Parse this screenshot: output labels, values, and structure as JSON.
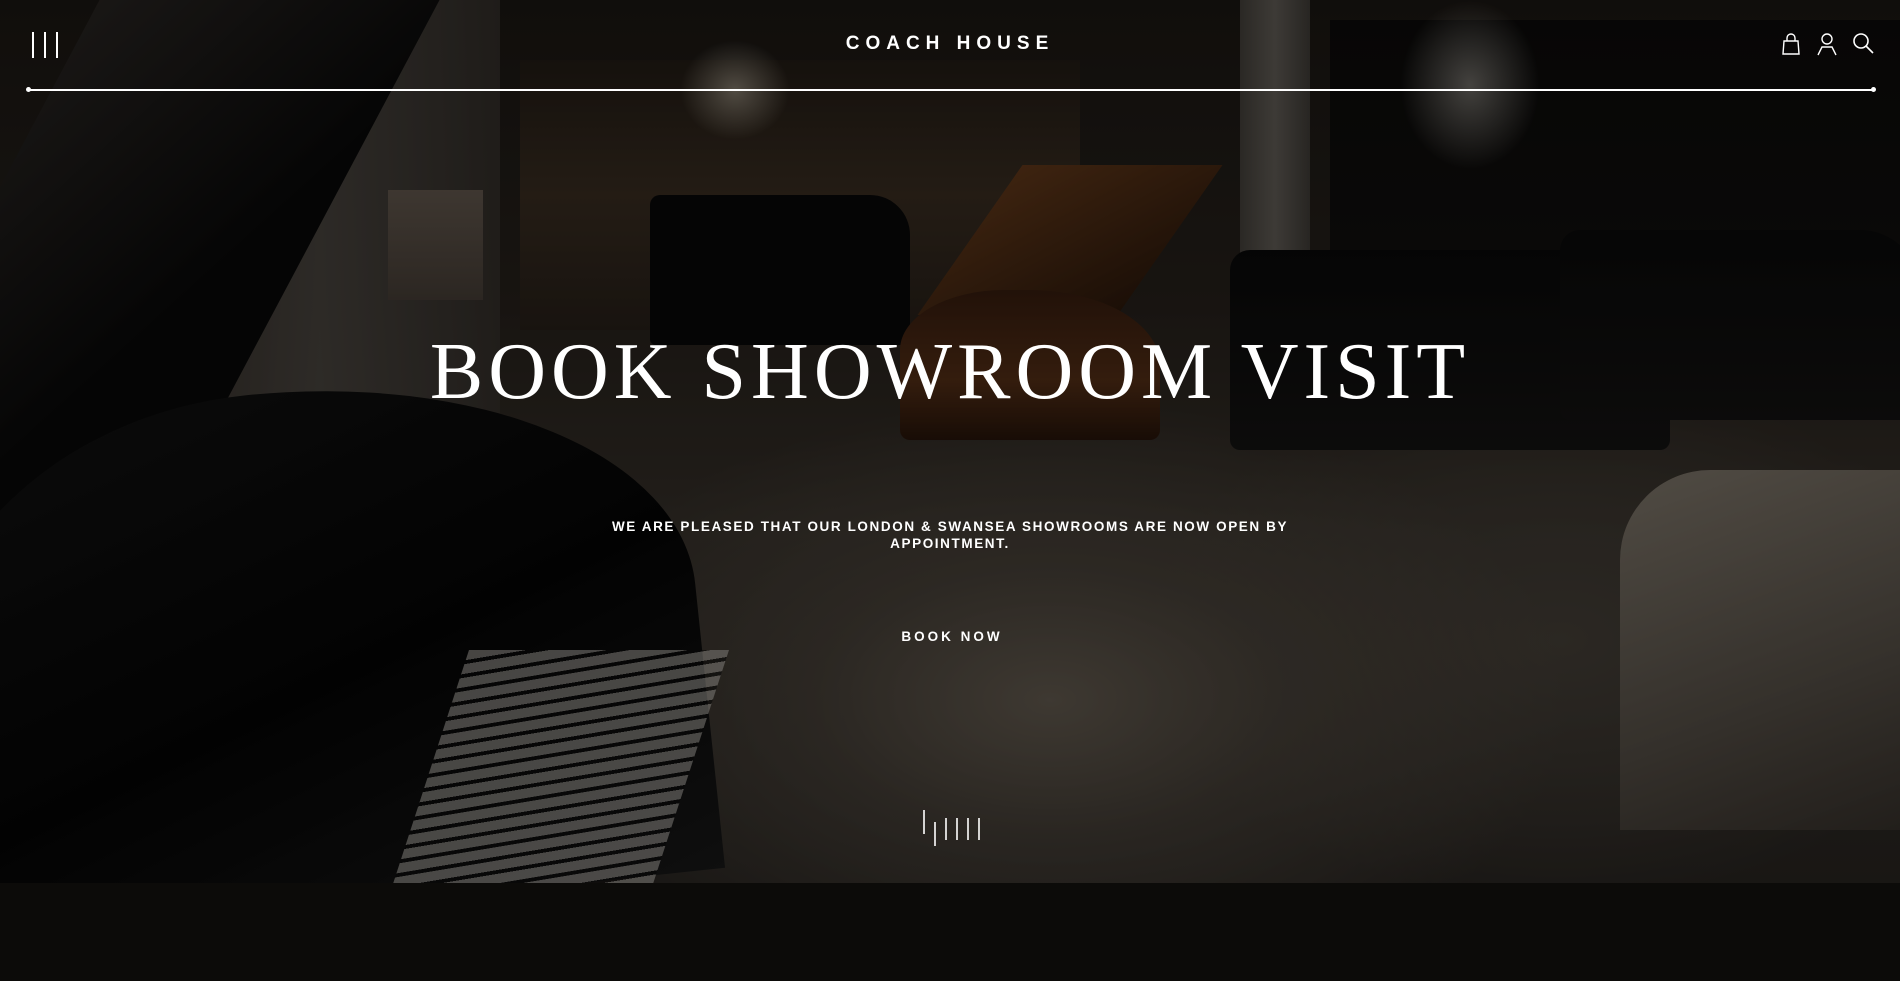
{
  "header": {
    "menu_icon": "hamburger-vertical-lines-icon",
    "brand": "COACH HOUSE",
    "icons": [
      "bag-icon",
      "user-icon",
      "search-icon"
    ]
  },
  "hero": {
    "background": "piano showroom photo (dimmed)",
    "title": "BOOK SHOWROOM VISIT",
    "subtitle": "WE ARE PLEASED THAT OUR LONDON & SWANSEA SHOWROOMS ARE NOW OPEN BY APPOINTMENT.",
    "cta_label": "BOOK NOW",
    "scroll_indicator_icon": "scroll-lines-icon"
  },
  "colors": {
    "text": "#ffffff",
    "page_background": "#0c0b09"
  }
}
